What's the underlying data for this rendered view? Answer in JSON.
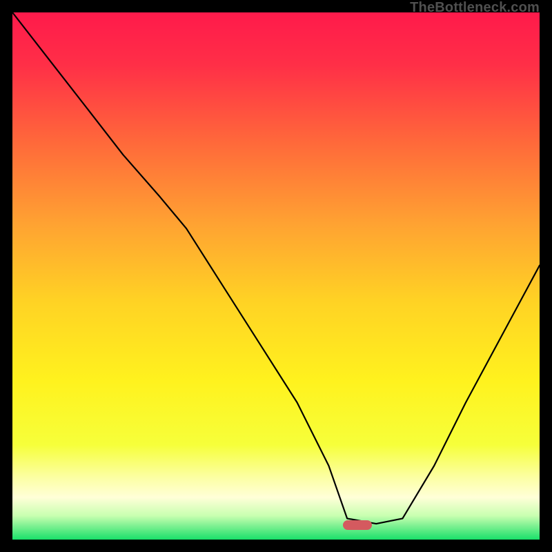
{
  "watermark": "TheBottleneck.com",
  "marker": {
    "x_frac": 0.655,
    "y_frac": 0.972
  },
  "gradient_stops": [
    {
      "offset": 0.0,
      "color": "#ff1a4b"
    },
    {
      "offset": 0.1,
      "color": "#ff2f47"
    },
    {
      "offset": 0.25,
      "color": "#ff6a3a"
    },
    {
      "offset": 0.4,
      "color": "#ffa232"
    },
    {
      "offset": 0.55,
      "color": "#ffd324"
    },
    {
      "offset": 0.7,
      "color": "#fff21e"
    },
    {
      "offset": 0.82,
      "color": "#f6ff3a"
    },
    {
      "offset": 0.88,
      "color": "#fcffa0"
    },
    {
      "offset": 0.92,
      "color": "#ffffd8"
    },
    {
      "offset": 0.955,
      "color": "#c8ffb0"
    },
    {
      "offset": 0.975,
      "color": "#7af090"
    },
    {
      "offset": 1.0,
      "color": "#19e06a"
    }
  ],
  "chart_data": {
    "type": "line",
    "title": "",
    "xlabel": "",
    "ylabel": "",
    "xlim": [
      0,
      1
    ],
    "ylim": [
      0,
      1
    ],
    "note": "Dimensionless V-shaped bottleneck curve over a color gradient. x/y are normalized fractions of the plot area (origin at bottom-left).",
    "series": [
      {
        "name": "bottleneck-curve",
        "x": [
          0.0,
          0.07,
          0.14,
          0.21,
          0.28,
          0.33,
          0.4,
          0.47,
          0.54,
          0.6,
          0.635,
          0.69,
          0.74,
          0.8,
          0.86,
          0.93,
          1.0
        ],
        "y": [
          1.0,
          0.91,
          0.82,
          0.73,
          0.65,
          0.59,
          0.48,
          0.37,
          0.26,
          0.14,
          0.04,
          0.03,
          0.04,
          0.14,
          0.26,
          0.39,
          0.52
        ]
      }
    ],
    "marker": {
      "x": 0.655,
      "y": 0.028,
      "color": "#d45a5f"
    }
  }
}
